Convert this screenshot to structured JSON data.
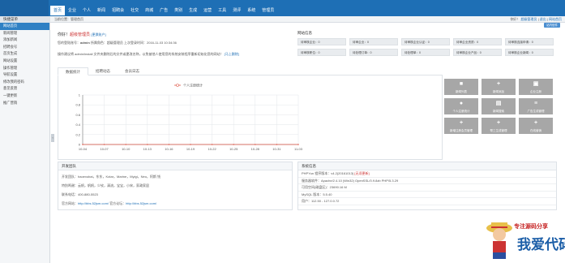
{
  "nav": {
    "items": [
      "首页",
      "企业",
      "个人",
      "新闻",
      "招聘会",
      "社交",
      "商城",
      "广告",
      "类别",
      "生成",
      "运营",
      "工具",
      "测评",
      "系统",
      "管理员"
    ],
    "active_index": 0
  },
  "menu_title": "快捷菜单",
  "breadcrumb": "当前位置：管理首页",
  "user_bar": {
    "prefix": "你好！",
    "role": "超级管理员",
    "sep1": "，",
    "links": [
      "超级管理员",
      "退出",
      "网站首页"
    ],
    "mail_label": "站内信件"
  },
  "sidebar": {
    "items": [
      "网站首页",
      "新闻管理",
      "添加新闻",
      "招聘会号",
      "首页生成",
      "网站设置",
      "操作管理",
      "导航设置",
      "修改我的密码",
      "意见反馈",
      "一键更新",
      "推广营销"
    ],
    "active_index": 0
  },
  "welcome": {
    "hello": "你好！",
    "role": "超级管理员",
    "role_link": "[更换账户]",
    "line2_prefix": "您的登陆账号：",
    "account": "admin",
    "line2_mid": " 所属角色：超级管理员  上次登录时间：2016-11-03 10:34:36",
    "line3_text": "操作建议将 admin/install 文件夹删除后的文件或更改名称，以免被他人使用您的系统安装程序重新初始化您的网站！",
    "line3_link": "[马上删除]"
  },
  "site_stats": {
    "title": "网站信息",
    "items": [
      "待审核企业：0",
      "待审企业：0",
      "待审核企业认证：0",
      "待审企业资质：0",
      "待审核连接申请：0",
      "待审核职位：0",
      "待处理订单：0",
      "待处理单：0",
      "待审核企业产品：0",
      "待审核企业新闻：0"
    ]
  },
  "tabs": [
    "数据统计",
    "招聘动态",
    "会员日志"
  ],
  "tabs_active": 0,
  "chart_data": {
    "type": "line",
    "x": [
      "10-04",
      "10-07",
      "10-10",
      "10-13",
      "10-16",
      "10-19",
      "10-22",
      "10-25",
      "10-28",
      "10-31",
      "11-03"
    ],
    "series": [
      {
        "name": "个人注册统计",
        "values": [
          0,
          0,
          0,
          0,
          0,
          0,
          0,
          0,
          0,
          0,
          0
        ]
      }
    ],
    "ylim": [
      0,
      1
    ],
    "yticks": [
      "0",
      "0.2",
      "0.4",
      "0.6",
      "0.8",
      "1"
    ],
    "legend": "top",
    "grid": true,
    "series_color": "#e05a4a"
  },
  "quick_buttons": [
    {
      "icon": "■",
      "label": "新闻列表"
    },
    {
      "icon": "+",
      "label": "新闻添加"
    },
    {
      "icon": "▣",
      "label": "企业注册"
    },
    {
      "icon": "●",
      "label": "个人注册统计"
    },
    {
      "icon": "▤",
      "label": "新闻搜索"
    },
    {
      "icon": "≡",
      "label": "广告生成管理"
    },
    {
      "icon": "+",
      "label": "新增注册会员管理"
    },
    {
      "icon": "+",
      "label": "帮工生成管理"
    },
    {
      "icon": "+",
      "label": "在线营销"
    }
  ],
  "dev_team": {
    "title": "开发团队",
    "rows": [
      {
        "label": "开发团队：",
        "text": "haoexubai，东东，Kotar，Marine，Myigi，Neo，阿斯 钱"
      },
      {
        "label": "特别鸣谢：",
        "text": "云帆，帆帆，少钦，清流，宝宝，小宋，家政家居"
      },
      {
        "label": "联系电话：",
        "text": "400-880-5523"
      },
      {
        "label": "官方网站：",
        "link": "http://bbs.52jsm.com/",
        "mid": " 官方论坛：",
        "link2": "http://bbs.52jsm.com/"
      }
    ]
  },
  "sys_info": {
    "title": "系统信息",
    "rows": [
      {
        "label": "PHPYun 程序版本：",
        "text": "v4.2(20161013)",
        "red": " [无须更新]"
      },
      {
        "label": "服务器软件：",
        "text": "Apache/2.4.10 (Win32) OpenSSL/0.9.8zb PHP/5.3.29"
      },
      {
        "label": "可用空间(磁盘区)：",
        "text": "23690.16 M"
      },
      {
        "label": "MySQL 版本：",
        "text": "5.5.40"
      },
      {
        "label": "用户：",
        "text": "112.50 - 127.0.0.72"
      }
    ]
  },
  "watermark": {
    "slogan": "专注源码分享",
    "name": "我爱代码"
  }
}
